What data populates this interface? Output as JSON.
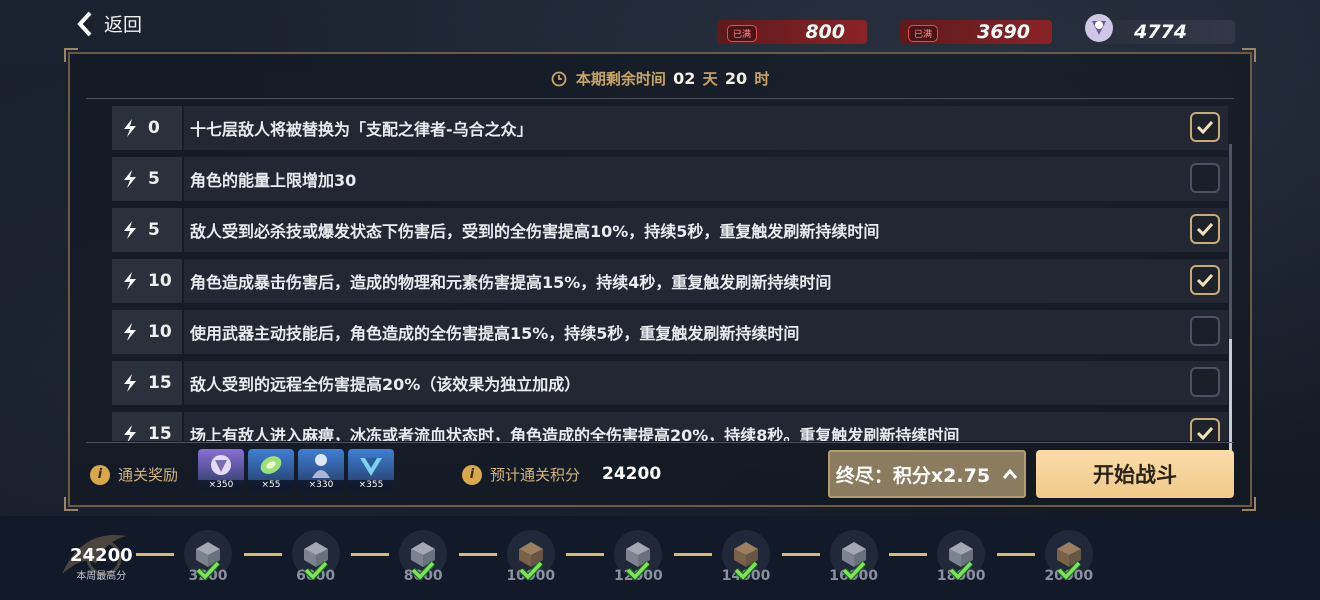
{
  "nav": {
    "back_label": "返回"
  },
  "resources": [
    {
      "badge": "已满",
      "value": "800",
      "icon": "crystal-icon"
    },
    {
      "badge": "已满",
      "value": "3690",
      "icon": "orange-crystal-icon"
    },
    {
      "badge": "",
      "value": "4774",
      "icon": "emblem-icon"
    }
  ],
  "timer": {
    "prefix": "本期剩余时间",
    "days": "02",
    "day_unit": "天",
    "hours": "20",
    "hour_unit": "时"
  },
  "modifiers": [
    {
      "cost": "0",
      "text": "十七层敌人将被替换为「支配之律者-乌合之众」",
      "checked": true
    },
    {
      "cost": "5",
      "text": "角色的能量上限增加30",
      "checked": false
    },
    {
      "cost": "5",
      "text": "敌人受到必杀技或爆发状态下伤害后，受到的全伤害提高10%，持续5秒，重复触发刷新持续时间",
      "checked": true
    },
    {
      "cost": "10",
      "text": "角色造成暴击伤害后，造成的物理和元素伤害提高15%，持续4秒，重复触发刷新持续时间",
      "checked": true
    },
    {
      "cost": "10",
      "text": "使用武器主动技能后，角色造成的全伤害提高15%，持续5秒，重复触发刷新持续时间",
      "checked": false
    },
    {
      "cost": "15",
      "text": "敌人受到的远程全伤害提高20%（该效果为独立加成）",
      "checked": false
    },
    {
      "cost": "15",
      "text": "场上有敌人进入麻痹，冰冻或者流血状态时，角色造成的全伤害提高20%，持续8秒。重复触发刷新持续时间",
      "checked": true
    }
  ],
  "rewards": {
    "label": "通关奖励",
    "items": [
      {
        "qty": "×350",
        "icon": "emblem-reward-icon",
        "color": "#8a6fd6"
      },
      {
        "qty": "×55",
        "icon": "gem-reward-icon",
        "color": "#3f7fd6"
      },
      {
        "qty": "×330",
        "icon": "figure-reward-icon",
        "color": "#3f7fd6"
      },
      {
        "qty": "×355",
        "icon": "crest-reward-icon",
        "color": "#3f7fd6"
      }
    ]
  },
  "estimate": {
    "label": "预计通关积分",
    "value": "24200"
  },
  "difficulty_button": {
    "label": "终尽：积分x2.75"
  },
  "start_button": {
    "label": "开始战斗"
  },
  "weekly_best": {
    "value": "24200",
    "label": "本周最高分"
  },
  "milestones": [
    {
      "score": "3200",
      "claimed": true,
      "tier": "silver"
    },
    {
      "score": "6000",
      "claimed": true,
      "tier": "silver"
    },
    {
      "score": "8000",
      "claimed": true,
      "tier": "silver"
    },
    {
      "score": "10000",
      "claimed": true,
      "tier": "bronze"
    },
    {
      "score": "12000",
      "claimed": true,
      "tier": "silver"
    },
    {
      "score": "14000",
      "claimed": true,
      "tier": "bronze"
    },
    {
      "score": "16000",
      "claimed": true,
      "tier": "silver"
    },
    {
      "score": "18000",
      "claimed": true,
      "tier": "silver"
    },
    {
      "score": "20000",
      "claimed": true,
      "tier": "bronze"
    }
  ]
}
